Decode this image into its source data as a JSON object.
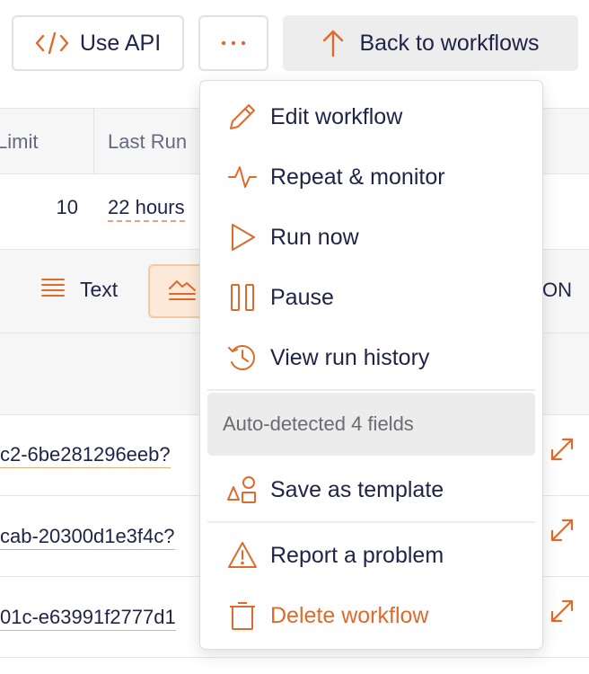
{
  "toolbar": {
    "api_label": "Use API",
    "more_label": "...",
    "back_label": "Back to workflows",
    "api_icon": "code-icon",
    "back_icon": "arrow-up-icon"
  },
  "table": {
    "headers": [
      "Limit",
      "Last Run"
    ],
    "row": {
      "limit": "10",
      "last_run": "22 hours"
    }
  },
  "view_toggle": {
    "text_label": "Text",
    "json_label": "ON",
    "text_icon": "lines-icon",
    "active_icon": "image-icon"
  },
  "data_rows": [
    "c2-6be281296eeb?",
    "cab-20300d1e3f4c?",
    "01c-e63991f2777d1"
  ],
  "menu": {
    "items": [
      {
        "label": "Edit workflow",
        "icon": "pencil-icon"
      },
      {
        "label": "Repeat & monitor",
        "icon": "pulse-icon"
      },
      {
        "label": "Run now",
        "icon": "play-icon"
      },
      {
        "label": "Pause",
        "icon": "pause-icon"
      },
      {
        "label": "View run history",
        "icon": "history-icon"
      }
    ],
    "section_label": "Auto-detected 4 fields",
    "template_label": "Save as template",
    "report_label": "Report a problem",
    "delete_label": "Delete workflow"
  },
  "colors": {
    "accent": "#e0692c",
    "text": "#1f2347",
    "muted": "#6b6b72",
    "active_bg": "#fde9d7"
  }
}
